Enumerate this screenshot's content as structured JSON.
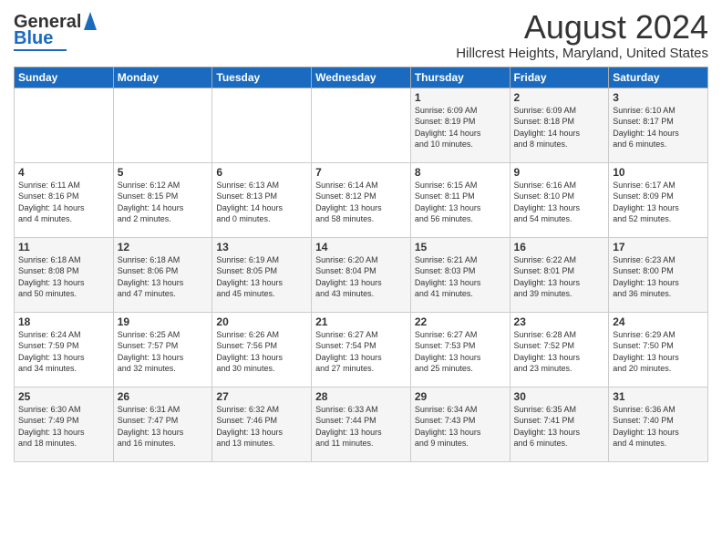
{
  "header": {
    "logo_line1": "General",
    "logo_line2": "Blue",
    "main_title": "August 2024",
    "subtitle": "Hillcrest Heights, Maryland, United States"
  },
  "days_of_week": [
    "Sunday",
    "Monday",
    "Tuesday",
    "Wednesday",
    "Thursday",
    "Friday",
    "Saturday"
  ],
  "weeks": [
    [
      {
        "date": "",
        "info": ""
      },
      {
        "date": "",
        "info": ""
      },
      {
        "date": "",
        "info": ""
      },
      {
        "date": "",
        "info": ""
      },
      {
        "date": "1",
        "info": "Sunrise: 6:09 AM\nSunset: 8:19 PM\nDaylight: 14 hours\nand 10 minutes."
      },
      {
        "date": "2",
        "info": "Sunrise: 6:09 AM\nSunset: 8:18 PM\nDaylight: 14 hours\nand 8 minutes."
      },
      {
        "date": "3",
        "info": "Sunrise: 6:10 AM\nSunset: 8:17 PM\nDaylight: 14 hours\nand 6 minutes."
      }
    ],
    [
      {
        "date": "4",
        "info": "Sunrise: 6:11 AM\nSunset: 8:16 PM\nDaylight: 14 hours\nand 4 minutes."
      },
      {
        "date": "5",
        "info": "Sunrise: 6:12 AM\nSunset: 8:15 PM\nDaylight: 14 hours\nand 2 minutes."
      },
      {
        "date": "6",
        "info": "Sunrise: 6:13 AM\nSunset: 8:13 PM\nDaylight: 14 hours\nand 0 minutes."
      },
      {
        "date": "7",
        "info": "Sunrise: 6:14 AM\nSunset: 8:12 PM\nDaylight: 13 hours\nand 58 minutes."
      },
      {
        "date": "8",
        "info": "Sunrise: 6:15 AM\nSunset: 8:11 PM\nDaylight: 13 hours\nand 56 minutes."
      },
      {
        "date": "9",
        "info": "Sunrise: 6:16 AM\nSunset: 8:10 PM\nDaylight: 13 hours\nand 54 minutes."
      },
      {
        "date": "10",
        "info": "Sunrise: 6:17 AM\nSunset: 8:09 PM\nDaylight: 13 hours\nand 52 minutes."
      }
    ],
    [
      {
        "date": "11",
        "info": "Sunrise: 6:18 AM\nSunset: 8:08 PM\nDaylight: 13 hours\nand 50 minutes."
      },
      {
        "date": "12",
        "info": "Sunrise: 6:18 AM\nSunset: 8:06 PM\nDaylight: 13 hours\nand 47 minutes."
      },
      {
        "date": "13",
        "info": "Sunrise: 6:19 AM\nSunset: 8:05 PM\nDaylight: 13 hours\nand 45 minutes."
      },
      {
        "date": "14",
        "info": "Sunrise: 6:20 AM\nSunset: 8:04 PM\nDaylight: 13 hours\nand 43 minutes."
      },
      {
        "date": "15",
        "info": "Sunrise: 6:21 AM\nSunset: 8:03 PM\nDaylight: 13 hours\nand 41 minutes."
      },
      {
        "date": "16",
        "info": "Sunrise: 6:22 AM\nSunset: 8:01 PM\nDaylight: 13 hours\nand 39 minutes."
      },
      {
        "date": "17",
        "info": "Sunrise: 6:23 AM\nSunset: 8:00 PM\nDaylight: 13 hours\nand 36 minutes."
      }
    ],
    [
      {
        "date": "18",
        "info": "Sunrise: 6:24 AM\nSunset: 7:59 PM\nDaylight: 13 hours\nand 34 minutes."
      },
      {
        "date": "19",
        "info": "Sunrise: 6:25 AM\nSunset: 7:57 PM\nDaylight: 13 hours\nand 32 minutes."
      },
      {
        "date": "20",
        "info": "Sunrise: 6:26 AM\nSunset: 7:56 PM\nDaylight: 13 hours\nand 30 minutes."
      },
      {
        "date": "21",
        "info": "Sunrise: 6:27 AM\nSunset: 7:54 PM\nDaylight: 13 hours\nand 27 minutes."
      },
      {
        "date": "22",
        "info": "Sunrise: 6:27 AM\nSunset: 7:53 PM\nDaylight: 13 hours\nand 25 minutes."
      },
      {
        "date": "23",
        "info": "Sunrise: 6:28 AM\nSunset: 7:52 PM\nDaylight: 13 hours\nand 23 minutes."
      },
      {
        "date": "24",
        "info": "Sunrise: 6:29 AM\nSunset: 7:50 PM\nDaylight: 13 hours\nand 20 minutes."
      }
    ],
    [
      {
        "date": "25",
        "info": "Sunrise: 6:30 AM\nSunset: 7:49 PM\nDaylight: 13 hours\nand 18 minutes."
      },
      {
        "date": "26",
        "info": "Sunrise: 6:31 AM\nSunset: 7:47 PM\nDaylight: 13 hours\nand 16 minutes."
      },
      {
        "date": "27",
        "info": "Sunrise: 6:32 AM\nSunset: 7:46 PM\nDaylight: 13 hours\nand 13 minutes."
      },
      {
        "date": "28",
        "info": "Sunrise: 6:33 AM\nSunset: 7:44 PM\nDaylight: 13 hours\nand 11 minutes."
      },
      {
        "date": "29",
        "info": "Sunrise: 6:34 AM\nSunset: 7:43 PM\nDaylight: 13 hours\nand 9 minutes."
      },
      {
        "date": "30",
        "info": "Sunrise: 6:35 AM\nSunset: 7:41 PM\nDaylight: 13 hours\nand 6 minutes."
      },
      {
        "date": "31",
        "info": "Sunrise: 6:36 AM\nSunset: 7:40 PM\nDaylight: 13 hours\nand 4 minutes."
      }
    ]
  ]
}
